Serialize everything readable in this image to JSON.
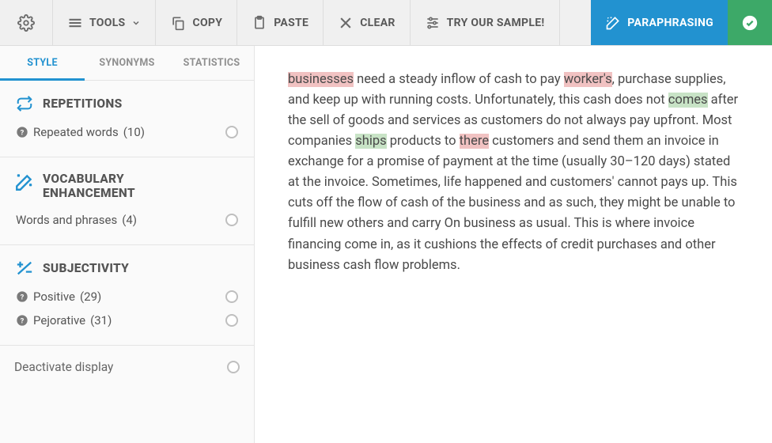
{
  "toolbar": {
    "tools_label": "TOOLS",
    "copy_label": "COPY",
    "paste_label": "PASTE",
    "clear_label": "CLEAR",
    "sample_label": "TRY OUR SAMPLE!",
    "paraphrase_label": "PARAPHRASING"
  },
  "tabs": {
    "style": "STYLE",
    "synonyms": "SYNONYMS",
    "statistics": "STATISTICS"
  },
  "sidebar": {
    "repetitions": {
      "title": "REPETITIONS",
      "repeated_words_label": "Repeated words",
      "repeated_words_count": "(10)"
    },
    "vocab": {
      "title_line1": "VOCABULARY",
      "title_line2": "ENHANCEMENT",
      "words_label": "Words and phrases",
      "words_count": "(4)"
    },
    "subjectivity": {
      "title": "SUBJECTIVITY",
      "positive_label": "Positive",
      "positive_count": "(29)",
      "pejorative_label": "Pejorative",
      "pejorative_count": "(31)"
    },
    "deactivate_label": "Deactivate display"
  },
  "content": {
    "segments": [
      {
        "text": "businesses",
        "hl": "pink"
      },
      {
        "text": " need a steady inflow of cash to pay "
      },
      {
        "text": "worker's",
        "hl": "pink"
      },
      {
        "text": ", purchase supplies, and keep up with running costs. Unfortunately, this cash does not "
      },
      {
        "text": "comes",
        "hl": "green"
      },
      {
        "text": " after the sell of goods and services as customers do not always pay upfront. Most companies "
      },
      {
        "text": "ships",
        "hl": "green"
      },
      {
        "text": " products to "
      },
      {
        "text": "there",
        "hl": "pink"
      },
      {
        "text": " customers and send them an invoice in exchange for a promise of payment at the time (usually 30–120 days) stated at the invoice. Sometimes, life happened and customers' cannot pays up. This cuts off the flow of cash of the business and as such, they might be unable to fulfill new others and carry On business as usual. This is where invoice financing come in, as it cushions the effects of credit purchases and other business cash flow problems."
      }
    ]
  }
}
